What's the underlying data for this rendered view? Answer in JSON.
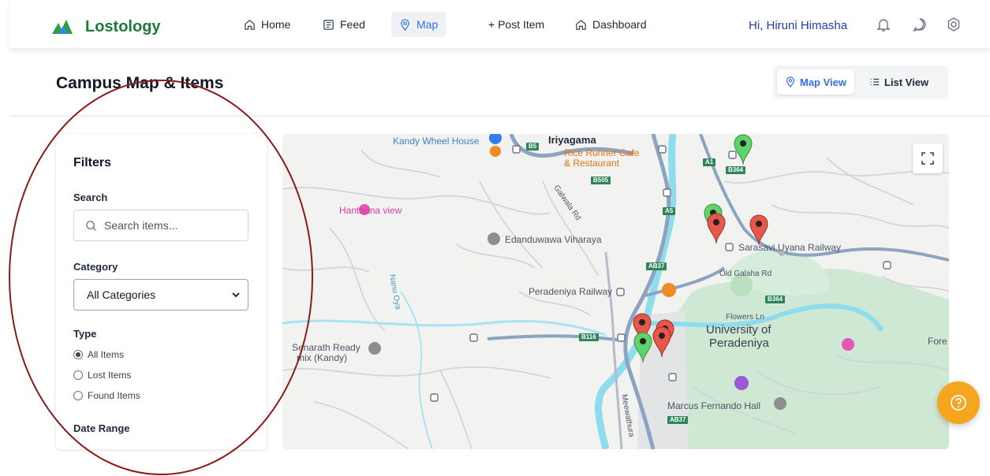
{
  "header": {
    "brand": "Lostology",
    "nav": [
      {
        "label": "Home",
        "icon": "home-icon"
      },
      {
        "label": "Feed",
        "icon": "feed-icon"
      },
      {
        "label": "Map",
        "icon": "map-pin-icon",
        "active": true
      },
      {
        "label": "+ Post Item",
        "icon": "plus-icon"
      },
      {
        "label": "Dashboard",
        "icon": "dashboard-icon"
      }
    ],
    "greeting": "Hi, Hiruni Himasha",
    "icons": [
      "bell-icon",
      "chat-icon",
      "settings-icon"
    ]
  },
  "page": {
    "title": "Campus Map & Items",
    "view_toggle": {
      "map": "Map View",
      "list": "List View",
      "selected": "Map View"
    }
  },
  "filters": {
    "title": "Filters",
    "search_label": "Search",
    "search_placeholder": "Search items...",
    "category_label": "Category",
    "category_value": "All Categories",
    "type_label": "Type",
    "type_options": [
      {
        "label": "All Items",
        "checked": true
      },
      {
        "label": "Lost Items",
        "checked": false
      },
      {
        "label": "Found Items",
        "checked": false
      }
    ],
    "date_label": "Date Range"
  },
  "map": {
    "labels": {
      "kandy_wheel": "Kandy Wheel House",
      "iriyagama": "Iriyagama",
      "rice_runner_1": "Rice Runner Cafe",
      "rice_runner_2": "& Restaurant",
      "hanthana": "Hanthana view",
      "edanduwawa": "Edanduwawa Viharaya",
      "galwala": "Galwala Rd",
      "nanu_oya": "Nanu Oya",
      "peradeniya_railway": "Peradeniya Railway",
      "sarasavi": "Sarasavi Uyana Railway",
      "old_galaha": "Old Galaha Rd",
      "flowers": "Flowers Ln",
      "uop_1": "University of",
      "uop_2": "Peradeniya",
      "senarath_1": "Senarath Ready",
      "senarath_2": "mix (Kandy)",
      "marcus": "Marcus Fernando Hall",
      "meewathura": "Meewathura",
      "fore": "Fore"
    },
    "road_tags": [
      "B5",
      "B505",
      "A1",
      "B364",
      "A5",
      "AB37",
      "B364",
      "B116",
      "AB37"
    ],
    "colors": {
      "lost_pin": "#e8584a",
      "found_pin": "#5dd36a",
      "river": "#8fdcef",
      "campus": "#cfe8d3"
    }
  },
  "annotation": {
    "color": "#8b1a1a"
  }
}
